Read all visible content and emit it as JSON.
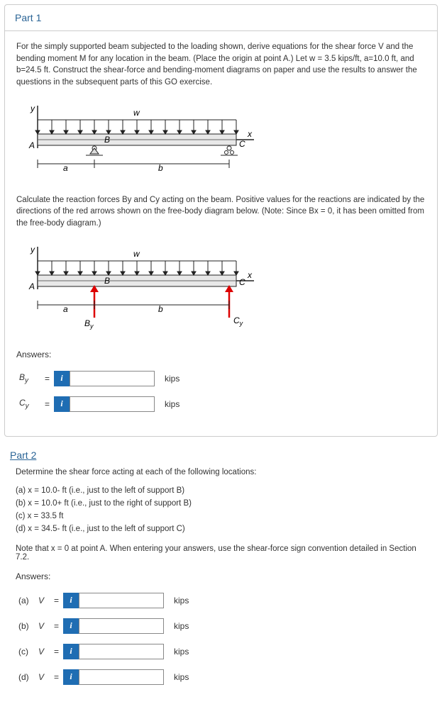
{
  "part1": {
    "header": "Part 1",
    "intro": "For the simply supported beam subjected to the loading shown, derive equations for the shear force V and the bending moment M for any location in the beam. (Place the origin at point A.) Let w = 3.5 kips/ft, a=10.0 ft, and b=24.5 ft. Construct the shear-force and bending-moment diagrams on paper and use the results to answer the questions in the subsequent parts of this GO exercise.",
    "diagram1": {
      "y": "y",
      "x": "x",
      "w": "w",
      "A": "A",
      "B": "B",
      "C": "C",
      "a": "a",
      "b": "b"
    },
    "calc_para": "Calculate the reaction forces By and Cy acting on the beam. Positive values for the reactions are indicated by the directions of the red arrows shown on the free-body diagram below. (Note: Since Bx = 0, it has been omitted from the free-body diagram.)",
    "diagram2": {
      "By": "By",
      "Cy": "Cy"
    },
    "answers_label": "Answers:",
    "rows": [
      {
        "lhs_html": "B<sub>y</sub>",
        "eq": "=",
        "info": "i",
        "unit": "kips"
      },
      {
        "lhs_html": "C<sub>y</sub>",
        "eq": "=",
        "info": "i",
        "unit": "kips"
      }
    ]
  },
  "part2": {
    "header": "Part 2",
    "intro": "Determine the shear force acting at each of the following locations:",
    "locs": [
      "(a) x = 10.0- ft (i.e., just to the left of support B)",
      "(b) x = 10.0+ ft (i.e., just to the right of support B)",
      "(c) x = 33.5 ft",
      "(d) x = 34.5- ft (i.e., just to the left of support C)"
    ],
    "note": "Note that x = 0 at point A. When entering your answers, use the shear-force sign convention detailed in Section 7.2.",
    "answers_label": "Answers:",
    "rows": [
      {
        "prefix": "(a)",
        "var": "V",
        "eq": "=",
        "info": "i",
        "unit": "kips"
      },
      {
        "prefix": "(b)",
        "var": "V",
        "eq": "=",
        "info": "i",
        "unit": "kips"
      },
      {
        "prefix": "(c)",
        "var": "V",
        "eq": "=",
        "info": "i",
        "unit": "kips"
      },
      {
        "prefix": "(d)",
        "var": "V",
        "eq": "=",
        "info": "i",
        "unit": "kips"
      }
    ]
  }
}
